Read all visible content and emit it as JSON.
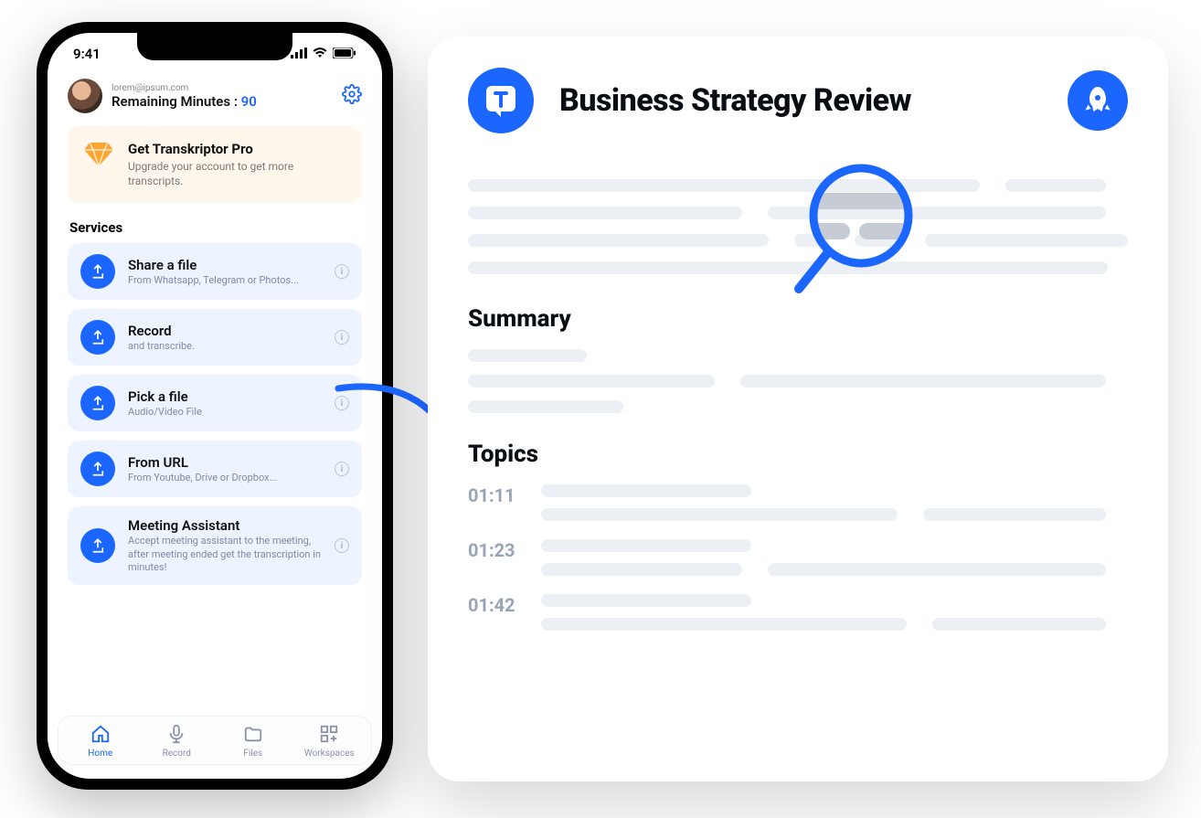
{
  "phone": {
    "status_time": "9:41",
    "profile": {
      "email": "lorem@ipsum.com",
      "remaining_label": "Remaining Minutes :",
      "remaining_value": "90"
    },
    "promo": {
      "title": "Get Transkriptor Pro",
      "subtitle": "Upgrade your account to get more transcripts."
    },
    "services_header": "Services",
    "services": [
      {
        "title": "Share a file",
        "subtitle": "From Whatsapp, Telegram or Photos..."
      },
      {
        "title": "Record",
        "subtitle": "and transcribe."
      },
      {
        "title": "Pick a file",
        "subtitle": "Audio/Video File"
      },
      {
        "title": "From URL",
        "subtitle": "From Youtube, Drive or Dropbox..."
      },
      {
        "title": "Meeting Assistant",
        "subtitle": "Accept meeting assistant to the meeting, after meeting ended get the transcription in minutes!"
      }
    ],
    "tabs": [
      {
        "label": "Home"
      },
      {
        "label": "Record"
      },
      {
        "label": "Files"
      },
      {
        "label": "Workspaces"
      }
    ]
  },
  "doc": {
    "title": "Business Strategy Review",
    "summary_header": "Summary",
    "topics_header": "Topics",
    "topics": [
      {
        "time": "01:11"
      },
      {
        "time": "01:23"
      },
      {
        "time": "01:42"
      }
    ]
  }
}
